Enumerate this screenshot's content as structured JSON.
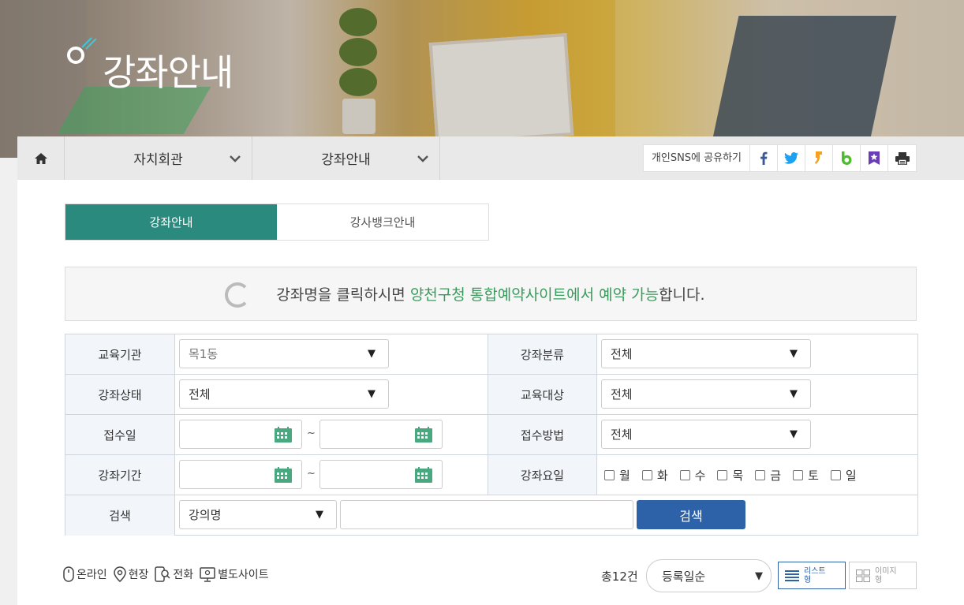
{
  "banner": {
    "title": "강좌안내"
  },
  "nav": {
    "home_icon": "home-icon",
    "menus": [
      {
        "label": "자치회관"
      },
      {
        "label": "강좌안내"
      }
    ],
    "share_label": "개인SNS에 공유하기",
    "share_buttons": [
      {
        "icon": "facebook-icon",
        "glyph": "f",
        "color": "#3b5998"
      },
      {
        "icon": "twitter-icon",
        "glyph": "t",
        "color": "#1da1f2"
      },
      {
        "icon": "kakaostory-icon",
        "glyph": "s",
        "color": "#f4a020"
      },
      {
        "icon": "band-icon",
        "glyph": "b",
        "color": "#4cbd2c"
      },
      {
        "icon": "bookmark-icon",
        "glyph": "★",
        "color": "#6a3cb5"
      },
      {
        "icon": "print-icon",
        "glyph": "p",
        "color": "#333333"
      }
    ]
  },
  "tabs": [
    {
      "label": "강좌안내",
      "active": true
    },
    {
      "label": "강사뱅크안내",
      "active": false
    }
  ],
  "notice": {
    "prefix": "강좌명을 클릭하시면 ",
    "highlight": "양천구청 통합예약사이트에서 예약 가능",
    "suffix": "합니다."
  },
  "search": {
    "institution_label": "교육기관",
    "institution_value": "목1동",
    "category_label": "강좌분류",
    "category_value": "전체",
    "status_label": "강좌상태",
    "status_value": "전체",
    "target_label": "교육대상",
    "target_value": "전체",
    "receipt_date_label": "접수일",
    "receipt_method_label": "접수방법",
    "receipt_method_value": "전체",
    "period_label": "강좌기간",
    "weekday_label": "강좌요일",
    "weekdays": [
      "월",
      "화",
      "수",
      "목",
      "금",
      "토",
      "일"
    ],
    "keyword_label": "검색",
    "keyword_type_value": "강의명",
    "keyword_value": "",
    "search_button": "검색",
    "tilde": "~"
  },
  "legend": [
    {
      "icon": "mouse-icon",
      "label": "온라인"
    },
    {
      "icon": "location-pin-icon",
      "label": "현장"
    },
    {
      "icon": "phone-icon",
      "label": "전화"
    },
    {
      "icon": "monitor-icon",
      "label": "별도사이트"
    }
  ],
  "results": {
    "total": "총12건",
    "sort_value": "등록일순",
    "view_list": "리스트형",
    "view_image": "이미지형"
  },
  "colors": {
    "accent_teal": "#2b8a7e",
    "button_blue": "#2d62a8",
    "highlight_green": "#3a9a5c"
  }
}
